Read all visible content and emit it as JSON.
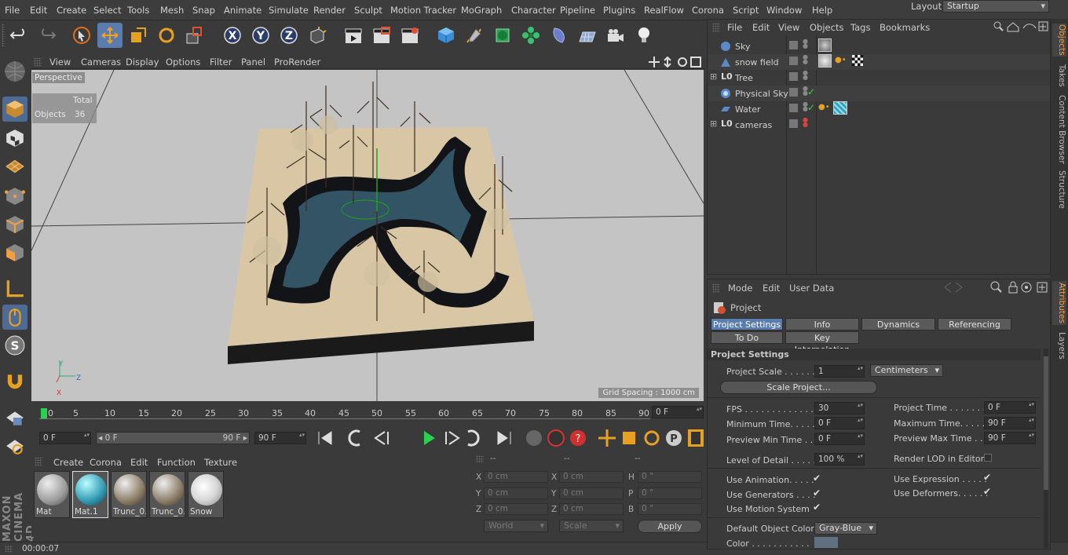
{
  "menu": [
    "File",
    "Edit",
    "Create",
    "Select",
    "Tools",
    "Mesh",
    "Snap",
    "Animate",
    "Simulate",
    "Render",
    "Sculpt",
    "Motion Tracker",
    "MoGraph",
    "Character",
    "Pipeline",
    "Plugins",
    "RealFlow",
    "Corona",
    "Script",
    "Window",
    "Help"
  ],
  "layout": {
    "label": "Layout:",
    "value": "Startup"
  },
  "viewport": {
    "menu": [
      "View",
      "Cameras",
      "Display",
      "Options",
      "Filter",
      "Panel",
      "ProRender"
    ],
    "camera": "Perspective",
    "stats_total": "Total",
    "stats_objects_label": "Objects",
    "stats_objects": "36",
    "grid_spacing": "Grid Spacing : 1000 cm"
  },
  "timeline": {
    "ticks": [
      "0",
      "5",
      "10",
      "15",
      "20",
      "25",
      "30",
      "35",
      "40",
      "45",
      "50",
      "55",
      "60",
      "65",
      "70",
      "75",
      "80",
      "85",
      "90"
    ],
    "current": "0 F"
  },
  "anim": {
    "start": "0 F",
    "range_start": "◂ 0 F",
    "range_end": "90 F ▸",
    "end": "90 F"
  },
  "material_manager": {
    "menu": [
      "Create",
      "Corona",
      "Edit",
      "Function",
      "Texture"
    ],
    "materials": [
      {
        "name": "Mat",
        "color": "#9a9a9a"
      },
      {
        "name": "Mat.1",
        "color": "#3aa0b8"
      },
      {
        "name": "Trunc_0.",
        "color": "#8a7c66"
      },
      {
        "name": "Trunc_0.",
        "color": "#8a7c66"
      },
      {
        "name": "Snow",
        "color": "#d8d8d8"
      }
    ]
  },
  "coord_manager": {
    "headers": [
      "--",
      "--",
      "--"
    ],
    "rows": [
      {
        "a": "X",
        "av": "0 cm",
        "b": "X",
        "bv": "0 cm",
        "c": "H",
        "cv": "0 °"
      },
      {
        "a": "Y",
        "av": "0 cm",
        "b": "Y",
        "bv": "0 cm",
        "c": "P",
        "cv": "0 °"
      },
      {
        "a": "Z",
        "av": "0 cm",
        "b": "Z",
        "bv": "0 cm",
        "c": "B",
        "cv": "0 °"
      }
    ],
    "mode1": "World",
    "mode2": "Scale",
    "apply": "Apply"
  },
  "status": {
    "time": "00:00:07"
  },
  "object_manager": {
    "menu": [
      "File",
      "Edit",
      "View",
      "Objects",
      "Tags",
      "Bookmarks"
    ],
    "objects": [
      {
        "name": "Sky"
      },
      {
        "name": "snow field"
      },
      {
        "name": "Tree"
      },
      {
        "name": "Physical Sky"
      },
      {
        "name": "Water"
      },
      {
        "name": "cameras"
      }
    ]
  },
  "attributes": {
    "menu": [
      "Mode",
      "Edit",
      "User Data"
    ],
    "title": "Project",
    "tabs": [
      "Project Settings",
      "Info",
      "Dynamics",
      "Referencing",
      "To Do",
      "Key Interpolation"
    ],
    "section": "Project Settings",
    "project_scale_label": "Project Scale . . . . . .",
    "project_scale_value": "1",
    "units": "Centimeters",
    "scale_button": "Scale Project...",
    "fps_label": "FPS . . . . . . . . . . . . . .",
    "fps": "30",
    "project_time_label": "Project Time . . . . . . .",
    "project_time": "0 F",
    "min_time_label": "Minimum Time. . . . . . .",
    "min_time": "0 F",
    "max_time_label": "Maximum Time. . . . . .",
    "max_time": "90 F",
    "prev_min_label": "Preview Min Time . . .",
    "prev_min": "0 F",
    "prev_max_label": "Preview Max Time . . .",
    "prev_max": "90 F",
    "lod_label": "Level of Detail . . . . .",
    "lod": "100 %",
    "render_lod_label": "Render LOD in Editor",
    "use_animation": "Use Animation. . . . .",
    "use_expression": "Use Expression . . . . .",
    "use_generators": "Use Generators . . . .",
    "use_deformers": "Use Deformers. . . . . .",
    "use_motion": "Use Motion System",
    "default_color_label": "Default Object Color",
    "default_color": "Gray-Blue",
    "color_label": "Color . . . . . . . . . . ."
  },
  "right_tabs": [
    "Objects",
    "Takes",
    "Content Browser",
    "Structure",
    "Attributes",
    "Layers"
  ],
  "brand": "MAXON CINEMA 4D"
}
